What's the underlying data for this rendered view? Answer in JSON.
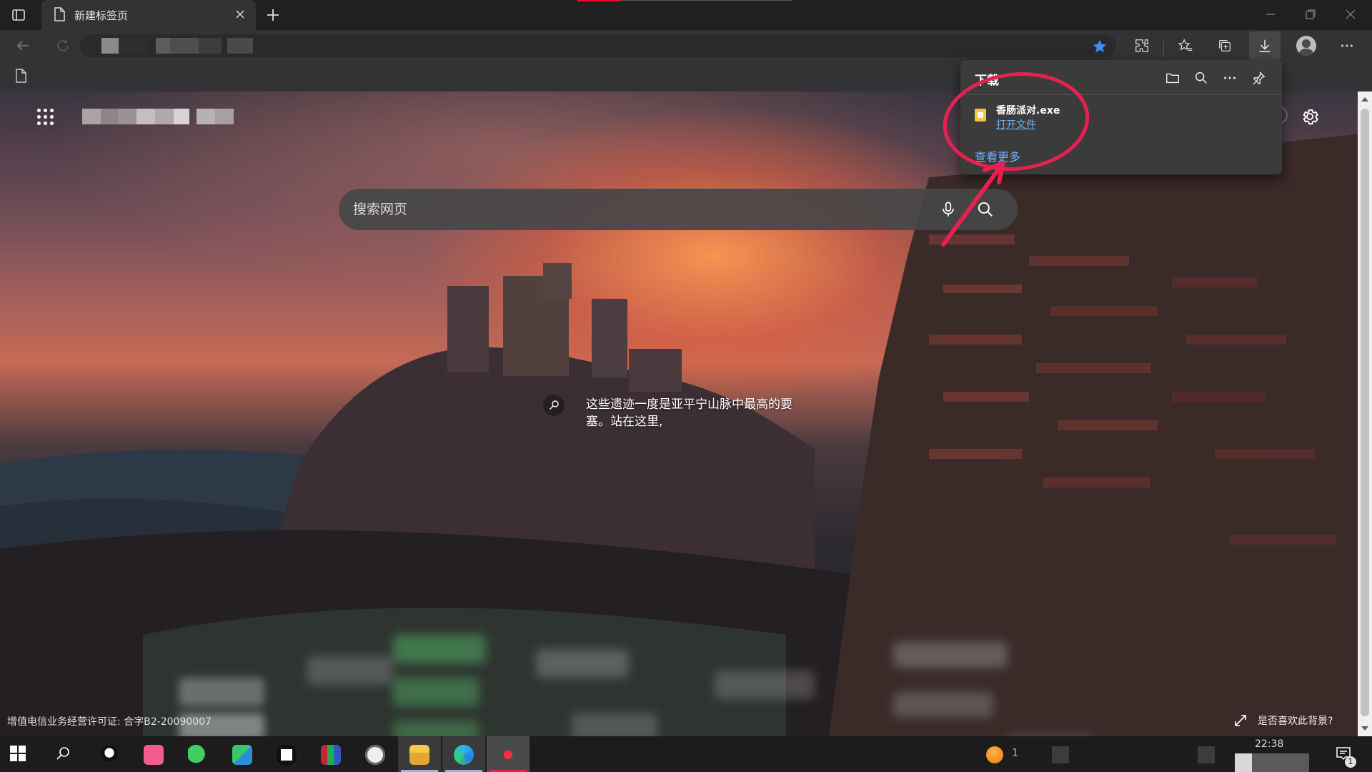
{
  "browser": {
    "tab": {
      "title": "新建标签页"
    },
    "address_bar": {
      "url": ""
    }
  },
  "ntp": {
    "search": {
      "placeholder": "搜索网页"
    },
    "caption": {
      "text": "这些遗迹一度是亚平宁山脉中最高的要塞。站在这里,"
    },
    "footer": {
      "license": "增值电信业务经营许可证: 合字B2-20090007",
      "like_background": "是否喜欢此背景?"
    }
  },
  "downloads_panel": {
    "title": "下载",
    "item": {
      "filename": "香肠派对.exe",
      "action": "打开文件"
    },
    "see_more": "查看更多"
  },
  "taskbar": {
    "apps": [
      "qq-icon",
      "bilibili-icon",
      "wechat-icon",
      "app-green-icon",
      "capcut-icon",
      "winrar-icon",
      "clock-app-icon",
      "file-explorer-icon",
      "edge-icon",
      "recording-app-icon"
    ],
    "tray_count": "1",
    "clock": "22:38",
    "notification_count": "1"
  },
  "colors": {
    "link": "#6cb4ff",
    "annotation": "#e8204f",
    "panel_bg": "#3b3b3b"
  }
}
